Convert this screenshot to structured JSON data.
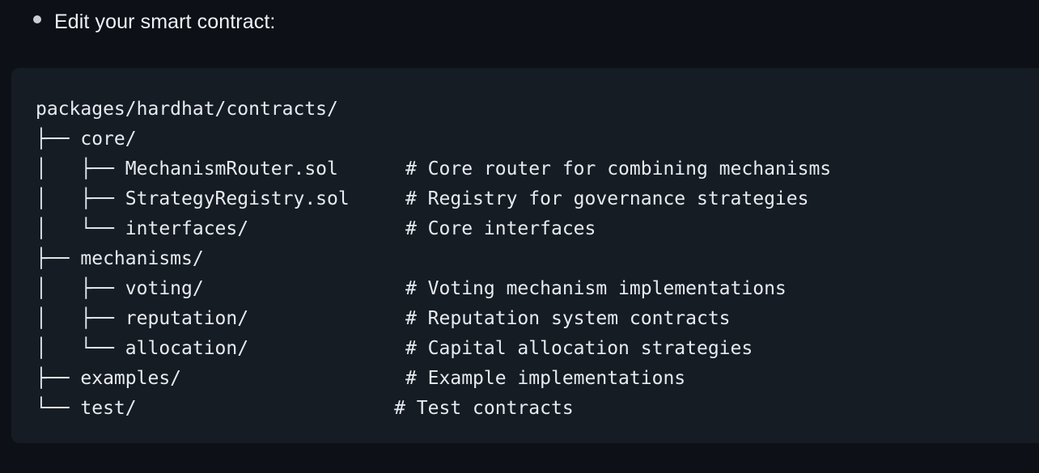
{
  "bullet": {
    "marker": "bullet-dot",
    "text": "Edit your smart contract:"
  },
  "code_block": {
    "language": "text",
    "background": "#161c24",
    "text_color": "#e7ebf0",
    "lines": [
      "packages/hardhat/contracts/",
      "├── core/",
      "│   ├── MechanismRouter.sol      # Core router for combining mechanisms",
      "│   ├── StrategyRegistry.sol     # Registry for governance strategies",
      "│   └── interfaces/              # Core interfaces",
      "├── mechanisms/",
      "│   ├── voting/                  # Voting mechanism implementations",
      "│   ├── reputation/              # Reputation system contracts",
      "│   └── allocation/              # Capital allocation strategies",
      "├── examples/                    # Example implementations",
      "└── test/                       # Test contracts"
    ],
    "tree": {
      "root": "packages/hardhat/contracts/",
      "entries": [
        {
          "depth": 1,
          "name": "core/",
          "comment": ""
        },
        {
          "depth": 2,
          "name": "MechanismRouter.sol",
          "comment": "# Core router for combining mechanisms"
        },
        {
          "depth": 2,
          "name": "StrategyRegistry.sol",
          "comment": "# Registry for governance strategies"
        },
        {
          "depth": 2,
          "name": "interfaces/",
          "comment": "# Core interfaces"
        },
        {
          "depth": 1,
          "name": "mechanisms/",
          "comment": ""
        },
        {
          "depth": 2,
          "name": "voting/",
          "comment": "# Voting mechanism implementations"
        },
        {
          "depth": 2,
          "name": "reputation/",
          "comment": "# Reputation system contracts"
        },
        {
          "depth": 2,
          "name": "allocation/",
          "comment": "# Capital allocation strategies"
        },
        {
          "depth": 1,
          "name": "examples/",
          "comment": "# Example implementations"
        },
        {
          "depth": 1,
          "name": "test/",
          "comment": "# Test contracts"
        }
      ]
    }
  },
  "colors": {
    "page_background": "#0d1117",
    "code_background": "#161c24",
    "heading_text": "#eef1f5",
    "code_text": "#e7ebf0",
    "bullet_marker": "#c9ced6"
  }
}
